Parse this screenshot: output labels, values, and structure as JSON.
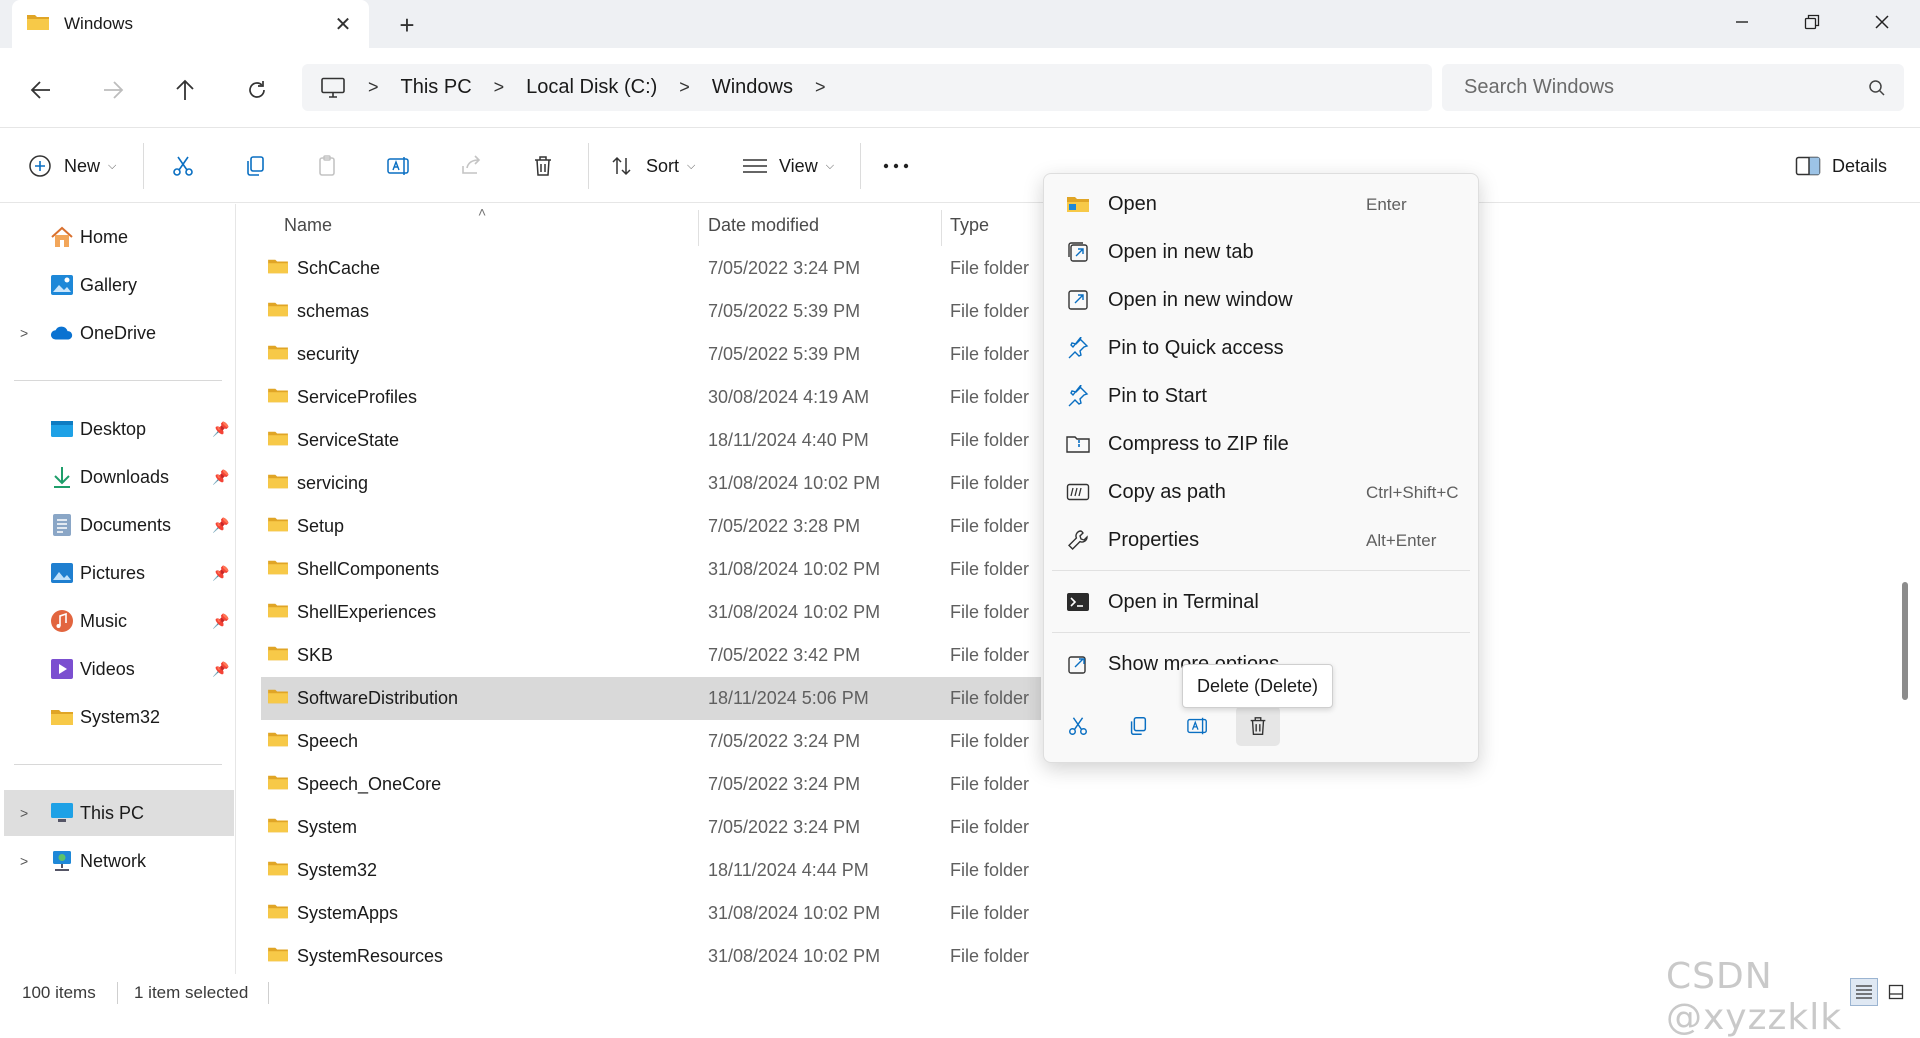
{
  "tab": {
    "title": "Windows",
    "close_glyph": "✕",
    "new_glyph": "+"
  },
  "window_controls": {
    "minimize": "minimize-icon",
    "restore": "restore-icon",
    "close": "close-icon"
  },
  "address": {
    "crumbs": [
      "This PC",
      "Local Disk (C:)",
      "Windows"
    ]
  },
  "search": {
    "placeholder": "Search Windows"
  },
  "toolbar": {
    "new_label": "New",
    "sort_label": "Sort",
    "view_label": "View",
    "details_label": "Details"
  },
  "sidebar": {
    "items": [
      {
        "label": "Home"
      },
      {
        "label": "Gallery"
      },
      {
        "label": "OneDrive"
      },
      {
        "label": "Desktop"
      },
      {
        "label": "Downloads"
      },
      {
        "label": "Documents"
      },
      {
        "label": "Pictures"
      },
      {
        "label": "Music"
      },
      {
        "label": "Videos"
      },
      {
        "label": "System32"
      },
      {
        "label": "This PC"
      },
      {
        "label": "Network"
      }
    ]
  },
  "columns": {
    "name": "Name",
    "date": "Date modified",
    "type": "Type"
  },
  "files": [
    {
      "name": "SchCache",
      "date": "7/05/2022 3:24 PM",
      "type": "File folder"
    },
    {
      "name": "schemas",
      "date": "7/05/2022 5:39 PM",
      "type": "File folder"
    },
    {
      "name": "security",
      "date": "7/05/2022 5:39 PM",
      "type": "File folder"
    },
    {
      "name": "ServiceProfiles",
      "date": "30/08/2024 4:19 AM",
      "type": "File folder"
    },
    {
      "name": "ServiceState",
      "date": "18/11/2024 4:40 PM",
      "type": "File folder"
    },
    {
      "name": "servicing",
      "date": "31/08/2024 10:02 PM",
      "type": "File folder"
    },
    {
      "name": "Setup",
      "date": "7/05/2022 3:28 PM",
      "type": "File folder"
    },
    {
      "name": "ShellComponents",
      "date": "31/08/2024 10:02 PM",
      "type": "File folder"
    },
    {
      "name": "ShellExperiences",
      "date": "31/08/2024 10:02 PM",
      "type": "File folder"
    },
    {
      "name": "SKB",
      "date": "7/05/2022 3:42 PM",
      "type": "File folder"
    },
    {
      "name": "SoftwareDistribution",
      "date": "18/11/2024 5:06 PM",
      "type": "File folder"
    },
    {
      "name": "Speech",
      "date": "7/05/2022 3:24 PM",
      "type": "File folder"
    },
    {
      "name": "Speech_OneCore",
      "date": "7/05/2022 3:24 PM",
      "type": "File folder"
    },
    {
      "name": "System",
      "date": "7/05/2022 3:24 PM",
      "type": "File folder"
    },
    {
      "name": "System32",
      "date": "18/11/2024 4:44 PM",
      "type": "File folder"
    },
    {
      "name": "SystemApps",
      "date": "31/08/2024 10:02 PM",
      "type": "File folder"
    },
    {
      "name": "SystemResources",
      "date": "31/08/2024 10:02 PM",
      "type": "File folder"
    }
  ],
  "selected_file": "SoftwareDistribution",
  "context_menu": {
    "items": [
      {
        "label": "Open",
        "shortcut": "Enter"
      },
      {
        "label": "Open in new tab",
        "shortcut": ""
      },
      {
        "label": "Open in new window",
        "shortcut": ""
      },
      {
        "label": "Pin to Quick access",
        "shortcut": ""
      },
      {
        "label": "Pin to Start",
        "shortcut": ""
      },
      {
        "label": "Compress to ZIP file",
        "shortcut": ""
      },
      {
        "label": "Copy as path",
        "shortcut": "Ctrl+Shift+C"
      },
      {
        "label": "Properties",
        "shortcut": "Alt+Enter"
      },
      {
        "label": "Open in Terminal",
        "shortcut": ""
      },
      {
        "label": "Show more options",
        "shortcut": ""
      }
    ],
    "tooltip": "Delete (Delete)"
  },
  "status": {
    "item_count": "100 items",
    "selection": "1 item selected"
  },
  "watermark": "CSDN @xyzzklk",
  "colors": {
    "folder_yellow": "#f7c948",
    "folder_dark": "#e0a526",
    "accent_blue": "#0a6fc2",
    "selected_row": "#d9d9d9"
  }
}
